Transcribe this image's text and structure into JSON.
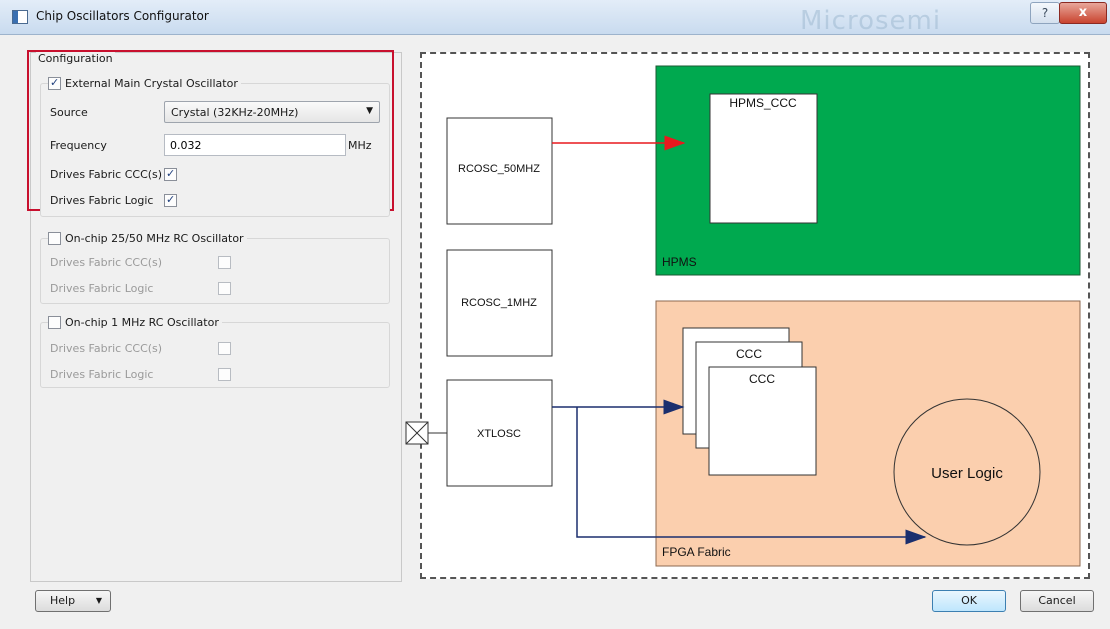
{
  "window": {
    "title": "Chip Oscillators Configurator",
    "watermark": "Microsemi",
    "help_icon": "?",
    "close_icon": "x"
  },
  "config": {
    "section_label": "Configuration",
    "external": {
      "label": "External Main Crystal Oscillator",
      "checked": true,
      "source_label": "Source",
      "source_value": "Crystal (32KHz-20MHz)",
      "frequency_label": "Frequency",
      "frequency_value": "0.032",
      "frequency_unit": "MHz",
      "drives_ccc_label": "Drives Fabric CCC(s)",
      "drives_ccc_checked": true,
      "drives_logic_label": "Drives Fabric Logic",
      "drives_logic_checked": true
    },
    "rc50": {
      "label": "On-chip 25/50 MHz RC Oscillator",
      "drives_ccc_label": "Drives Fabric CCC(s)",
      "drives_logic_label": "Drives Fabric Logic"
    },
    "rc1": {
      "label": "On-chip 1 MHz RC Oscillator",
      "drives_ccc_label": "Drives Fabric CCC(s)",
      "drives_logic_label": "Drives Fabric Logic"
    }
  },
  "diagram": {
    "hpms_label": "HPMS",
    "hpms_ccc_label": "HPMS_CCC",
    "rcosc50_label": "RCOSC_50MHZ",
    "rcosc1_label": "RCOSC_1MHZ",
    "xtlosc_label": "XTLOSC",
    "fabric_label": "FPGA Fabric",
    "ccc_label_1": "CCC",
    "ccc_label_2": "CCC",
    "user_logic_label": "User Logic",
    "colors": {
      "hpms": "#00a94f",
      "fabric": "#fbcfae",
      "red_arrow": "#e8191e",
      "blue_arrow": "#1b2f6e"
    }
  },
  "footer": {
    "help_label": "Help",
    "ok_label": "OK",
    "cancel_label": "Cancel"
  }
}
